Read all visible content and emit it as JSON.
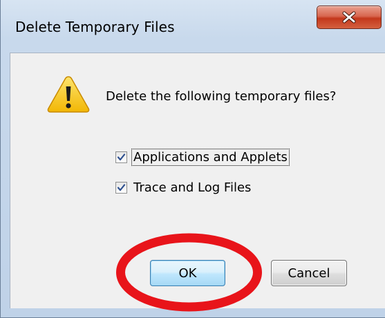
{
  "dialog": {
    "title": "Delete Temporary Files",
    "close_label": "X",
    "prompt": "Delete the following temporary files?",
    "options": [
      {
        "label": "Applications and Applets",
        "checked": true,
        "focused": true
      },
      {
        "label": "Trace and Log Files",
        "checked": true,
        "focused": false
      }
    ],
    "buttons": {
      "ok": "OK",
      "cancel": "Cancel"
    }
  },
  "colors": {
    "frame": "#bfd2e8",
    "client_background": "#f0f0f0",
    "close_button": "#c3381c",
    "ok_button": "#bee6fd",
    "highlight": "#e8141a",
    "warning_fill": "#f6c223"
  },
  "icons": {
    "warning": "warning-icon",
    "close": "close-icon",
    "check": "check-icon"
  },
  "annotation": {
    "type": "red-ellipse",
    "target": "ok-button"
  }
}
